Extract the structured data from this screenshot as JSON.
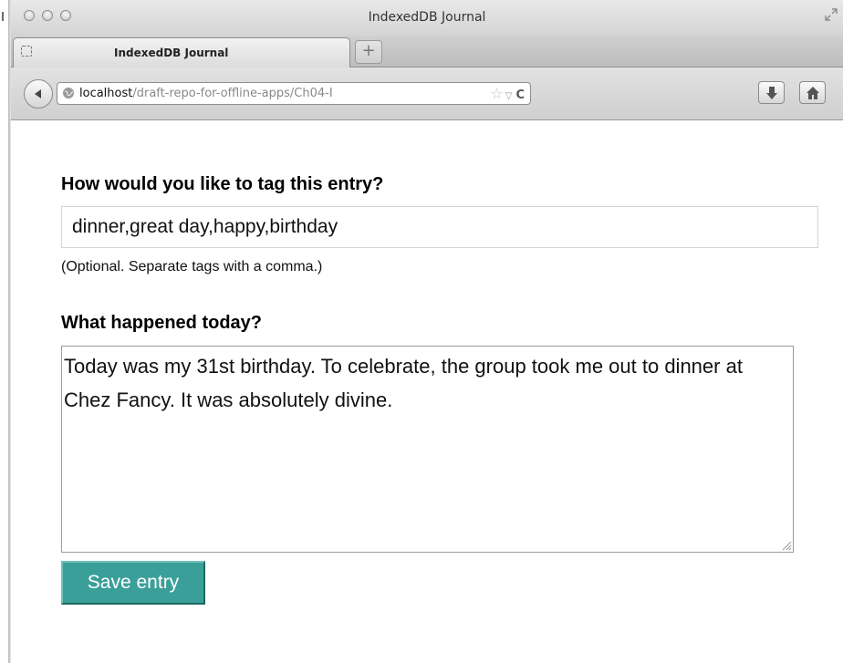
{
  "window": {
    "title": "IndexedDB Journal"
  },
  "tabs": [
    {
      "label": "IndexedDB Journal"
    }
  ],
  "newtab": {
    "label": "+"
  },
  "addressbar": {
    "host": "localhost",
    "path": "/draft-repo-for-offline-apps/Ch04-I"
  },
  "form": {
    "tags_label": "How would you like to tag this entry?",
    "tags_value": "dinner,great day,happy,birthday",
    "tags_hint": "(Optional. Separate tags with a comma.)",
    "entry_label": "What happened today?",
    "entry_value": "Today was my 31st birthday. To celebrate, the group took me out to dinner at Chez Fancy. It was absolutely divine.",
    "save_label": "Save entry"
  },
  "colors": {
    "save_button": "#3b9f99"
  },
  "icons": {
    "back": "back-arrow-icon",
    "site": "globe-icon",
    "bookmark": "star-icon",
    "history": "dropmark-icon",
    "reload": "reload-icon",
    "downloads": "download-arrow-icon",
    "home": "home-icon",
    "tab_favicon": "blank-page-icon",
    "fullscreen": "fullscreen-icon"
  }
}
